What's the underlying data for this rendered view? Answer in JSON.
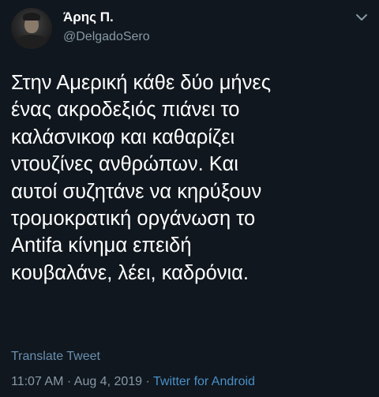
{
  "author": {
    "display_name": "Άρης Π.",
    "handle": "@DelgadoSero"
  },
  "header": {
    "menu_icon": "chevron-down-icon"
  },
  "tweet": {
    "lines": [
      "Στην Αμερική κάθε δύο μήνες",
      "ένας ακροδεξιός πιάνει το",
      "καλάσνικοφ  και καθαρίζει",
      "ντουζίνες ανθρώπων. Και",
      "αυτοί συζητάνε να κηρύξουν",
      "τρομοκρατική οργάνωση το",
      "Antifa κίνημα επειδή",
      "κουβαλάνε, λέει, καδρόνια."
    ]
  },
  "translate_label": "Translate Tweet",
  "meta": {
    "time": "11:07 AM",
    "separator": "·",
    "date": "Aug 4, 2019",
    "source": "Twitter for Android"
  },
  "colors": {
    "background": "#10171e",
    "secondary_text": "#8899a6",
    "link": "#4a90c8"
  }
}
